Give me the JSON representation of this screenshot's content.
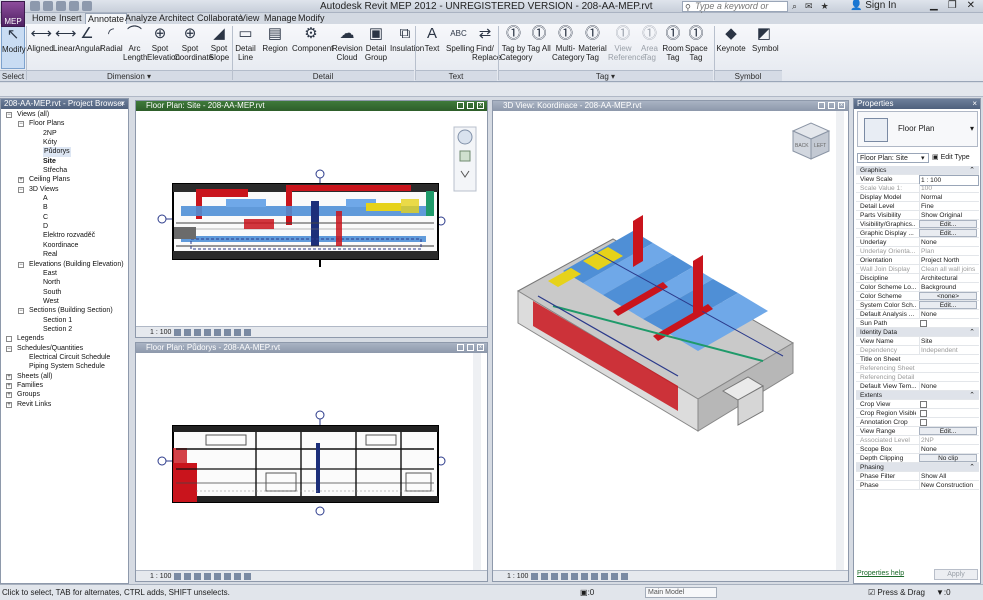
{
  "window": {
    "title": "Autodesk Revit MEP 2012 - UNREGISTERED VERSION -   208-AA-MEP.rvt",
    "app_button": "MEP",
    "search_placeholder": "Type a keyword or phrase",
    "sign_in": "Sign In"
  },
  "tabs": [
    "Home",
    "Insert",
    "Annotate",
    "Analyze",
    "Architect",
    "Collaborate",
    "View",
    "Manage",
    "Modify"
  ],
  "active_tab": "Annotate",
  "ribbon": {
    "buttons": [
      {
        "label": "Modify",
        "icon": "cursor"
      },
      {
        "label": "Aligned",
        "icon": "dim"
      },
      {
        "label": "Linear",
        "icon": "dim"
      },
      {
        "label": "Angular",
        "icon": "angle"
      },
      {
        "label": "Radial",
        "icon": "radial"
      },
      {
        "label": "Arc Length",
        "icon": "arc"
      },
      {
        "label": "Spot Elevation",
        "icon": "spot"
      },
      {
        "label": "Spot Coordinate",
        "icon": "spot"
      },
      {
        "label": "Spot Slope",
        "icon": "slope"
      },
      {
        "label": "Detail Line",
        "icon": "detail"
      },
      {
        "label": "Region",
        "icon": "region"
      },
      {
        "label": "Component",
        "icon": "component"
      },
      {
        "label": "Revision Cloud",
        "icon": "cloud"
      },
      {
        "label": "Detail Group",
        "icon": "group"
      },
      {
        "label": "Insulation",
        "icon": "insulation"
      },
      {
        "label": "Text",
        "icon": "text"
      },
      {
        "label": "Spelling",
        "icon": "spelling"
      },
      {
        "label": "Find/ Replace",
        "icon": "find"
      },
      {
        "label": "Tag by Category",
        "icon": "tag"
      },
      {
        "label": "Tag All",
        "icon": "tag"
      },
      {
        "label": "Multi- Category",
        "icon": "tag"
      },
      {
        "label": "Material Tag",
        "icon": "tag"
      },
      {
        "label": "View Reference",
        "icon": "tag"
      },
      {
        "label": "Area Tag",
        "icon": "tag"
      },
      {
        "label": "Room Tag",
        "icon": "tag"
      },
      {
        "label": "Space Tag",
        "icon": "tag"
      },
      {
        "label": "Keynote",
        "icon": "keynote"
      },
      {
        "label": "Symbol",
        "icon": "symbol"
      }
    ],
    "panels": [
      "Select",
      "Dimension ▾",
      "Detail",
      "Text",
      "Tag ▾",
      "Symbol"
    ]
  },
  "project_browser": {
    "title": "208-AA-MEP.rvt - Project Browser",
    "items": [
      {
        "label": "Views (all)",
        "level": 0,
        "toggle": "−"
      },
      {
        "label": "Floor Plans",
        "level": 1,
        "toggle": "−"
      },
      {
        "label": "2NP",
        "level": 2
      },
      {
        "label": "Kóty",
        "level": 2
      },
      {
        "label": "Půdorys",
        "level": 2,
        "highlight": true
      },
      {
        "label": "Site",
        "level": 2,
        "bold": true
      },
      {
        "label": "Střecha",
        "level": 2
      },
      {
        "label": "Ceiling Plans",
        "level": 1,
        "toggle": "+"
      },
      {
        "label": "3D Views",
        "level": 1,
        "toggle": "−"
      },
      {
        "label": "A",
        "level": 2
      },
      {
        "label": "B",
        "level": 2
      },
      {
        "label": "C",
        "level": 2
      },
      {
        "label": "D",
        "level": 2
      },
      {
        "label": "Elektro rozvaděč",
        "level": 2
      },
      {
        "label": "Koordinace",
        "level": 2
      },
      {
        "label": "Real",
        "level": 2
      },
      {
        "label": "Elevations (Building Elevation)",
        "level": 1,
        "toggle": "−"
      },
      {
        "label": "East",
        "level": 2
      },
      {
        "label": "North",
        "level": 2
      },
      {
        "label": "South",
        "level": 2
      },
      {
        "label": "West",
        "level": 2
      },
      {
        "label": "Sections (Building Section)",
        "level": 1,
        "toggle": "−"
      },
      {
        "label": "Section 1",
        "level": 2
      },
      {
        "label": "Section 2",
        "level": 2
      },
      {
        "label": "Legends",
        "level": 0,
        "toggle": ""
      },
      {
        "label": "Schedules/Quantities",
        "level": 0,
        "toggle": "−"
      },
      {
        "label": "Electrical Circuit Schedule",
        "level": 1
      },
      {
        "label": "Piping System Schedule",
        "level": 1
      },
      {
        "label": "Sheets (all)",
        "level": 0,
        "toggle": "+"
      },
      {
        "label": "Families",
        "level": 0,
        "toggle": "+"
      },
      {
        "label": "Groups",
        "level": 0,
        "toggle": "+"
      },
      {
        "label": "Revit Links",
        "level": 0,
        "toggle": "+"
      }
    ]
  },
  "views": {
    "site": {
      "title": "Floor Plan: Site - 208-AA-MEP.rvt",
      "scale": "1 : 100"
    },
    "podorys": {
      "title": "Floor Plan: Půdorys - 208-AA-MEP.rvt",
      "scale": "1 : 100"
    },
    "koordinace": {
      "title": "3D View: Koordinace - 208-AA-MEP.rvt",
      "scale": "1 : 100",
      "cube_labels": [
        "BACK",
        "LEFT"
      ]
    }
  },
  "properties": {
    "title": "Properties",
    "type_name": "Floor Plan",
    "selector": "Floor Plan: Site",
    "edit_type": "Edit Type",
    "rows": [
      {
        "kind": "group",
        "name": "Graphics"
      },
      {
        "name": "View Scale",
        "value": "1 : 100",
        "input": true
      },
      {
        "name": "Scale Value   1:",
        "value": "100",
        "ro": true
      },
      {
        "name": "Display Model",
        "value": "Normal"
      },
      {
        "name": "Detail Level",
        "value": "Fine"
      },
      {
        "name": "Parts Visibility",
        "value": "Show Original"
      },
      {
        "name": "Visibility/Graphics...",
        "value": "Edit...",
        "button": true
      },
      {
        "name": "Graphic Display ...",
        "value": "Edit...",
        "button": true
      },
      {
        "name": "Underlay",
        "value": "None"
      },
      {
        "name": "Underlay Orienta...",
        "value": "Plan",
        "ro": true
      },
      {
        "name": "Orientation",
        "value": "Project North"
      },
      {
        "name": "Wall Join Display",
        "value": "Clean all wall joins",
        "ro": true
      },
      {
        "name": "Discipline",
        "value": "Architectural"
      },
      {
        "name": "Color Scheme Lo...",
        "value": "Background"
      },
      {
        "name": "Color Scheme",
        "value": "<none>",
        "button": true
      },
      {
        "name": "System Color Sch...",
        "value": "Edit...",
        "button": true
      },
      {
        "name": "Default Analysis ...",
        "value": "None"
      },
      {
        "name": "Sun Path",
        "value": "",
        "check": true
      },
      {
        "kind": "group",
        "name": "Identity Data"
      },
      {
        "name": "View Name",
        "value": "Site"
      },
      {
        "name": "Dependency",
        "value": "Independent",
        "ro": true
      },
      {
        "name": "Title on Sheet",
        "value": ""
      },
      {
        "name": "Referencing Sheet",
        "value": "",
        "ro": true
      },
      {
        "name": "Referencing Detail",
        "value": "",
        "ro": true
      },
      {
        "name": "Default View Tem...",
        "value": "None"
      },
      {
        "kind": "group",
        "name": "Extents"
      },
      {
        "name": "Crop View",
        "value": "",
        "check": true
      },
      {
        "name": "Crop Region Visible",
        "value": "",
        "check": true
      },
      {
        "name": "Annotation Crop",
        "value": "",
        "check": true
      },
      {
        "name": "View Range",
        "value": "Edit...",
        "button": true
      },
      {
        "name": "Associated Level",
        "value": "2NP",
        "ro": true
      },
      {
        "name": "Scope Box",
        "value": "None"
      },
      {
        "name": "Depth Clipping",
        "value": "No clip",
        "button": true
      },
      {
        "kind": "group",
        "name": "Phasing"
      },
      {
        "name": "Phase Filter",
        "value": "Show All"
      },
      {
        "name": "Phase",
        "value": "New Construction"
      }
    ],
    "help": "Properties help",
    "apply": "Apply"
  },
  "status": {
    "text": "Click to select, TAB for alternates, CTRL adds, SHIFT unselects.",
    "zero": ":0",
    "model": "Main Model",
    "press": "Press & Drag",
    "filter": ":0"
  },
  "colors": {
    "accent": "#3f7a3a",
    "duct_blue": "#4f8fd6",
    "duct_red": "#c9141c",
    "pipe_yellow": "#e6d21a",
    "pipe_green": "#1f9a6a"
  }
}
